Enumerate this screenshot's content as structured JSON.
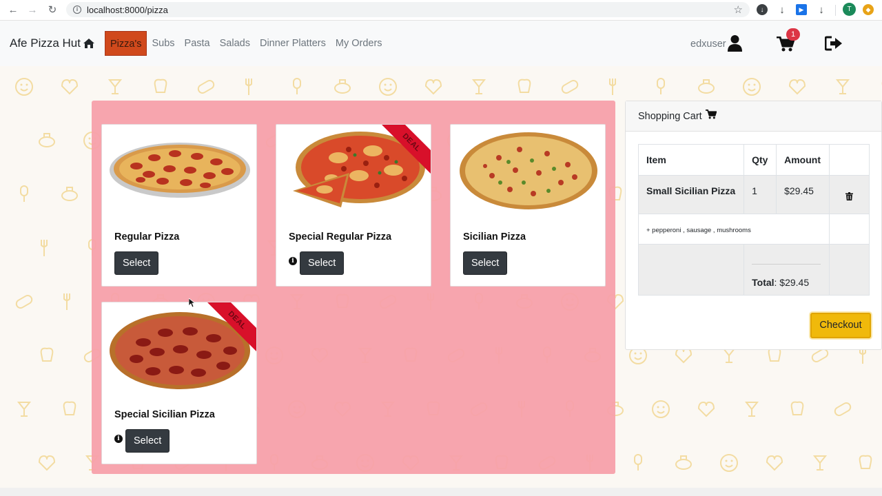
{
  "browser": {
    "url": "localhost:8000/pizza",
    "profile_initial": "T"
  },
  "navbar": {
    "brand": "Afe Pizza Hut",
    "menu": [
      {
        "label": "Pizza's",
        "active": true
      },
      {
        "label": "Subs"
      },
      {
        "label": "Pasta"
      },
      {
        "label": "Salads"
      },
      {
        "label": "Dinner Platters"
      },
      {
        "label": "My Orders"
      }
    ],
    "username": "edxuser",
    "cart_count": "1"
  },
  "products": [
    {
      "title": "Regular Pizza",
      "button": "Select",
      "deal": false,
      "info": false
    },
    {
      "title": "Special Regular Pizza",
      "button": "Select",
      "deal": true,
      "info": true,
      "ribbon": "DEAL"
    },
    {
      "title": "Sicilian Pizza",
      "button": "Select",
      "deal": false,
      "info": false
    },
    {
      "title": "Special Sicilian Pizza",
      "button": "Select",
      "deal": true,
      "info": true,
      "ribbon": "DEAL"
    }
  ],
  "cart": {
    "title": "Shopping Cart",
    "headers": [
      "Item",
      "Qty",
      "Amount"
    ],
    "item": {
      "name": "Small Sicilian Pizza",
      "qty": "1",
      "amount": "$29.45"
    },
    "toppings": "+ pepperoni , sausage , mushrooms",
    "total_label": "Total",
    "total_value": ": $29.45",
    "checkout": "Checkout"
  },
  "colors": {
    "active_menu": "#d0491c",
    "panel": "#f7a0aa",
    "checkout": "#f0b90b",
    "badge": "#dc3545",
    "ribbon": "#d8102a"
  }
}
